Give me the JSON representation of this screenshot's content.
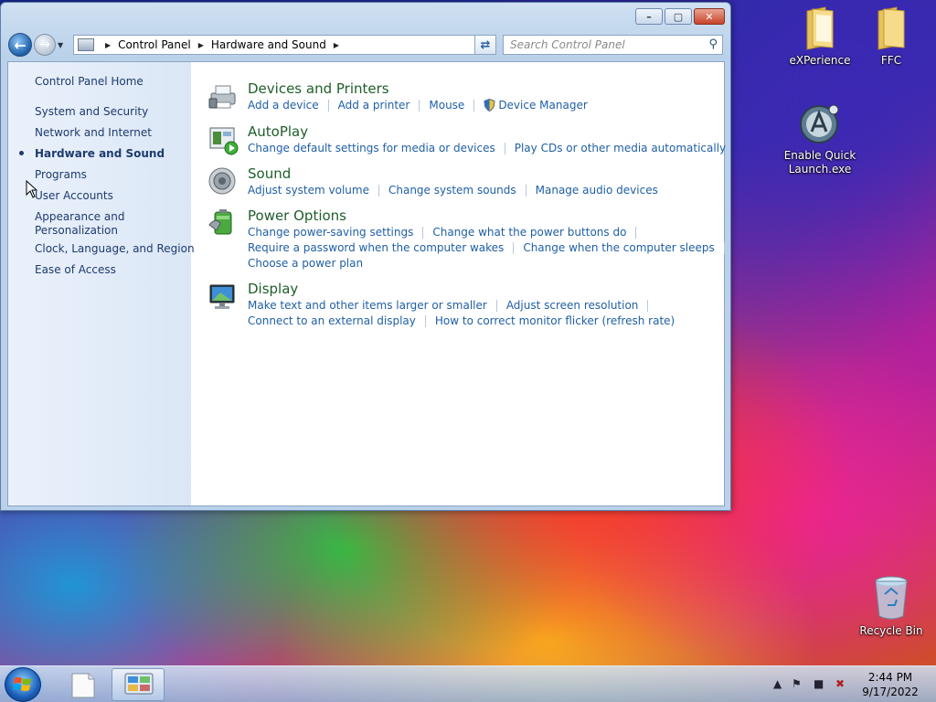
{
  "window": {
    "breadcrumb": [
      "Control Panel",
      "Hardware and Sound"
    ],
    "search_placeholder": "Search Control Panel"
  },
  "sidebar": {
    "items": [
      {
        "label": "Control Panel Home",
        "current": false
      },
      {
        "label": "System and Security",
        "current": false
      },
      {
        "label": "Network and Internet",
        "current": false
      },
      {
        "label": "Hardware and Sound",
        "current": true
      },
      {
        "label": "Programs",
        "current": false
      },
      {
        "label": "User Accounts",
        "current": false
      },
      {
        "label": "Appearance and",
        "label2": "Personalization",
        "current": false
      },
      {
        "label": "Clock, Language, and Region",
        "current": false
      },
      {
        "label": "Ease of Access",
        "current": false
      }
    ]
  },
  "categories": [
    {
      "title": "Devices and Printers",
      "icon": "printer-icon",
      "rows": [
        [
          "Add a device",
          "Add a printer",
          "Mouse",
          "Device Manager"
        ]
      ]
    },
    {
      "title": "AutoPlay",
      "icon": "autoplay-icon",
      "rows": [
        [
          "Change default settings for media or devices",
          "Play CDs or other media automatically"
        ]
      ]
    },
    {
      "title": "Sound",
      "icon": "speaker-icon",
      "rows": [
        [
          "Adjust system volume",
          "Change system sounds",
          "Manage audio devices"
        ]
      ]
    },
    {
      "title": "Power Options",
      "icon": "battery-icon",
      "rows": [
        [
          "Change power-saving settings",
          "Change what the power buttons do"
        ],
        [
          "Require a password when the computer wakes",
          "Change when the computer sleeps"
        ],
        [
          "Choose a power plan"
        ]
      ]
    },
    {
      "title": "Display",
      "icon": "monitor-icon",
      "rows": [
        [
          "Make text and other items larger or smaller",
          "Adjust screen resolution"
        ],
        [
          "Connect to an external display",
          "How to correct monitor flicker (refresh rate)"
        ]
      ]
    }
  ],
  "desktop": {
    "icons": [
      {
        "label": "eXPerience",
        "icon": "folder-icon"
      },
      {
        "label": "FFC",
        "icon": "folder-icon"
      },
      {
        "label": "Enable Quick",
        "label2": "Launch.exe",
        "icon": "app-icon"
      },
      {
        "label": "Recycle Bin",
        "icon": "recycle-bin-icon"
      }
    ]
  },
  "taskbar": {
    "time": "2:44 PM",
    "date": "9/17/2022"
  },
  "colors": {
    "link": "#1f5fa5",
    "category_title": "#1e5e2a",
    "sidebar_text": "#1e3a6d"
  }
}
